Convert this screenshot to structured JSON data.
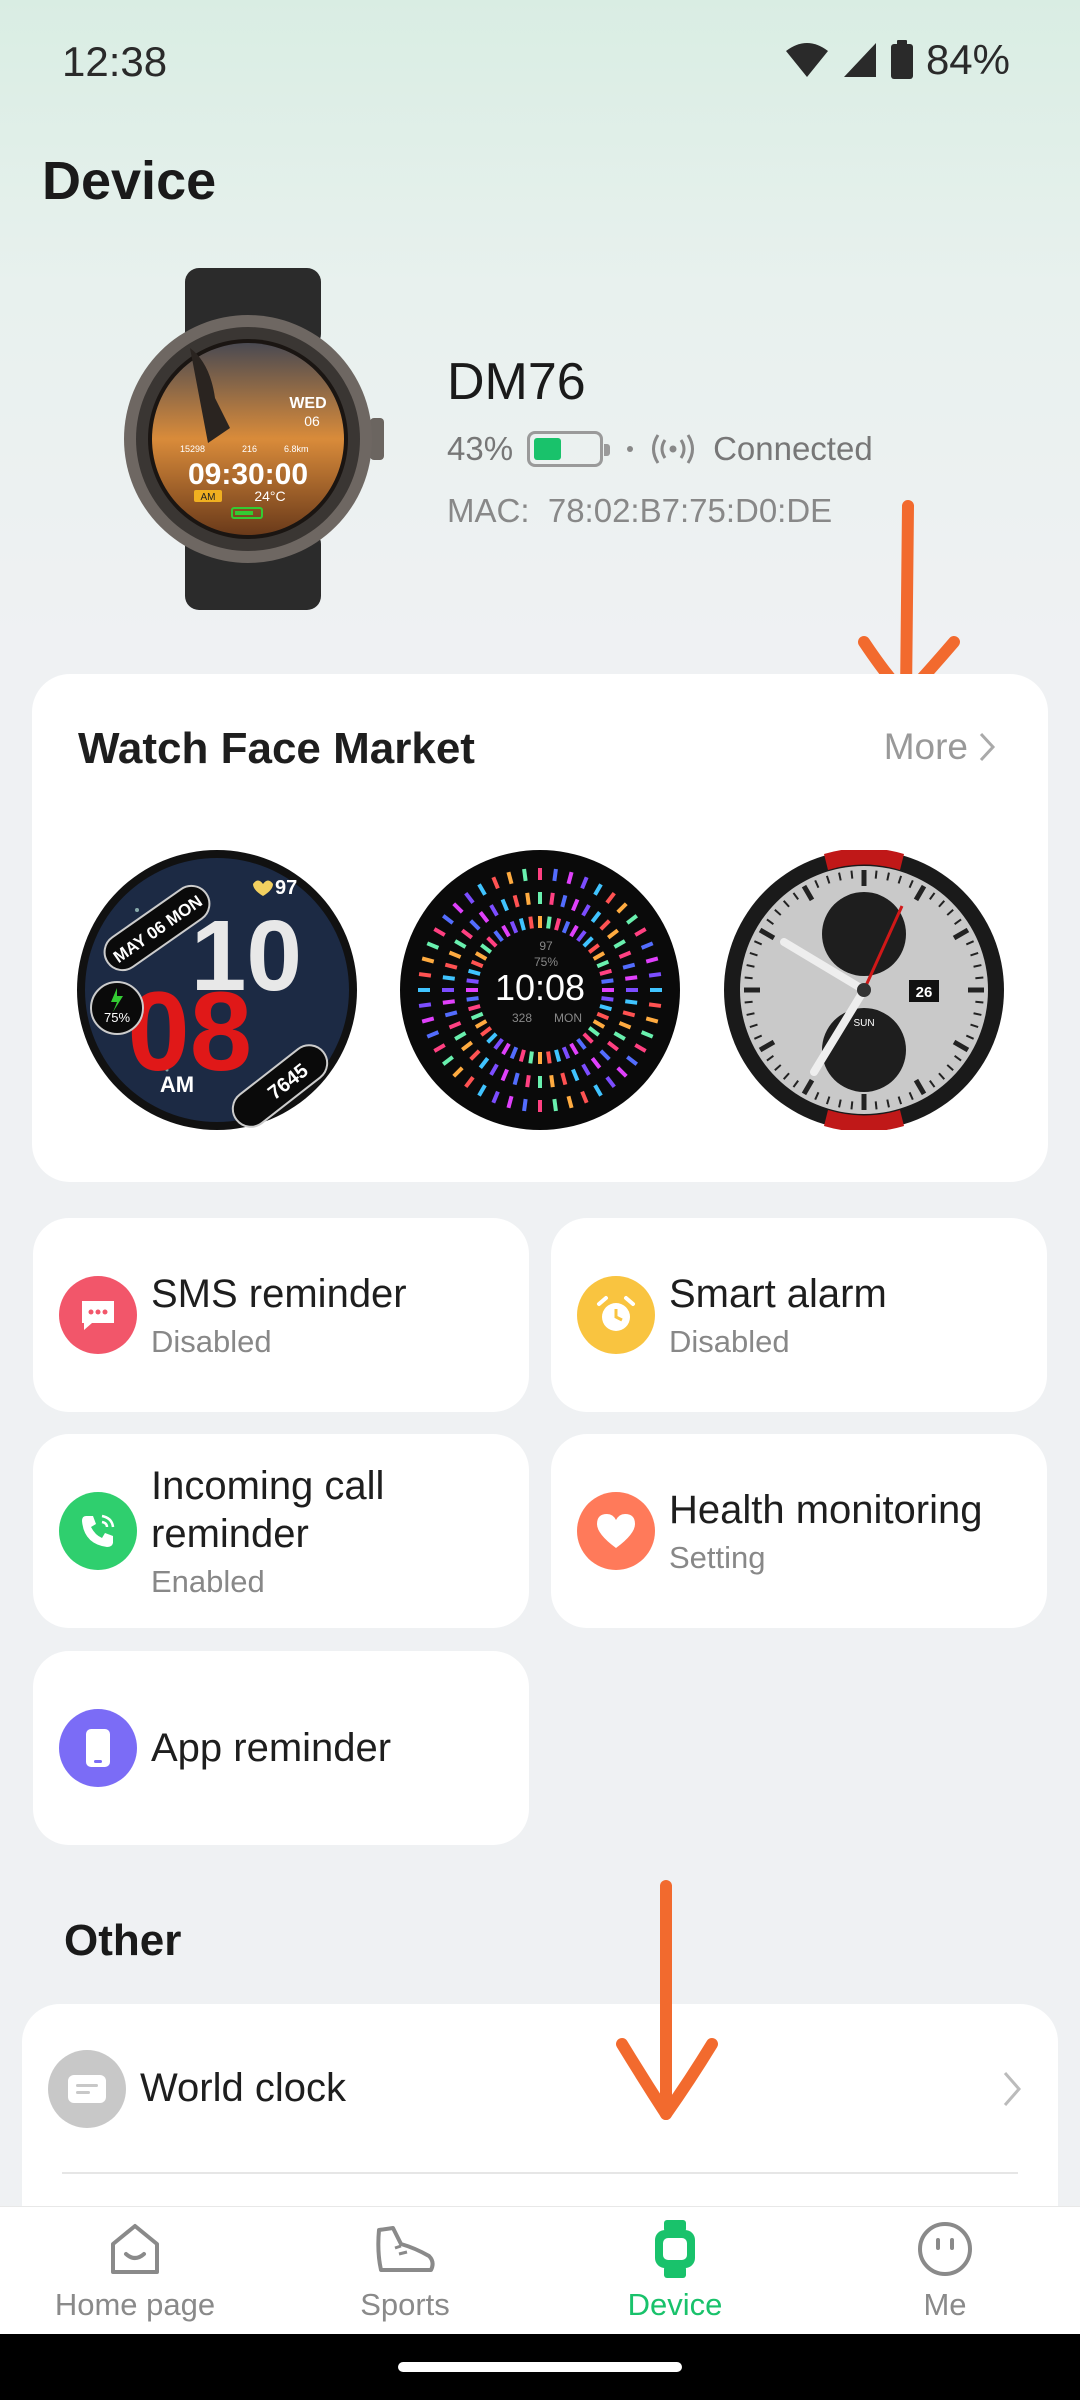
{
  "status_bar": {
    "time": "12:38",
    "battery_pct": "84%"
  },
  "page_title": "Device",
  "device": {
    "name": "DM76",
    "battery": "43%",
    "battery_level": 0.43,
    "connection": "Connected",
    "mac_label": "MAC:",
    "mac": "78:02:B7:75:D0:DE",
    "watch_preview": {
      "day": "WED",
      "date": "06",
      "time": "09:30:00",
      "ampm": "AM",
      "temp": "24°C",
      "steps": "15298",
      "cal": "216",
      "dist": "6.8km"
    }
  },
  "watch_face_market": {
    "title": "Watch Face Market",
    "more_label": "More",
    "faces": [
      {
        "date_text": "MAY 06 MON",
        "hour": "10",
        "minute": "08",
        "ampm": "AM",
        "heart": "97",
        "battery": "75%",
        "steps": "7645"
      },
      {
        "time": "10:08",
        "heart": "97",
        "battery": "75%",
        "cal": "328",
        "day": "MON"
      },
      {
        "date": "26",
        "day": "SUN"
      }
    ]
  },
  "features": [
    {
      "label": "SMS reminder",
      "status": "Disabled",
      "icon": "sms-icon",
      "color": "#f2566a"
    },
    {
      "label": "Smart alarm",
      "status": "Disabled",
      "icon": "alarm-clock-icon",
      "color": "#f9c440"
    },
    {
      "label": "Incoming call reminder",
      "label_line1": "Incoming call",
      "label_line2": "reminder",
      "status": "Enabled",
      "icon": "phone-icon",
      "color": "#2fcf6e"
    },
    {
      "label": "Health monitoring",
      "status": "Setting",
      "icon": "heart-icon",
      "color": "#ff7a5a"
    },
    {
      "label": "App reminder",
      "status": "",
      "icon": "phone-device-icon",
      "color": "#7b6cf6"
    }
  ],
  "other": {
    "title": "Other",
    "items": [
      {
        "label": "World clock",
        "icon": "world-clock-icon"
      }
    ]
  },
  "nav": [
    {
      "label": "Home page",
      "icon": "home-face-icon"
    },
    {
      "label": "Sports",
      "icon": "sneaker-icon"
    },
    {
      "label": "Device",
      "icon": "watch-icon",
      "active": true
    },
    {
      "label": "Me",
      "icon": "smiley-icon"
    }
  ],
  "colors": {
    "accent": "#19c26b",
    "annotation_arrow": "#f26a2e"
  }
}
